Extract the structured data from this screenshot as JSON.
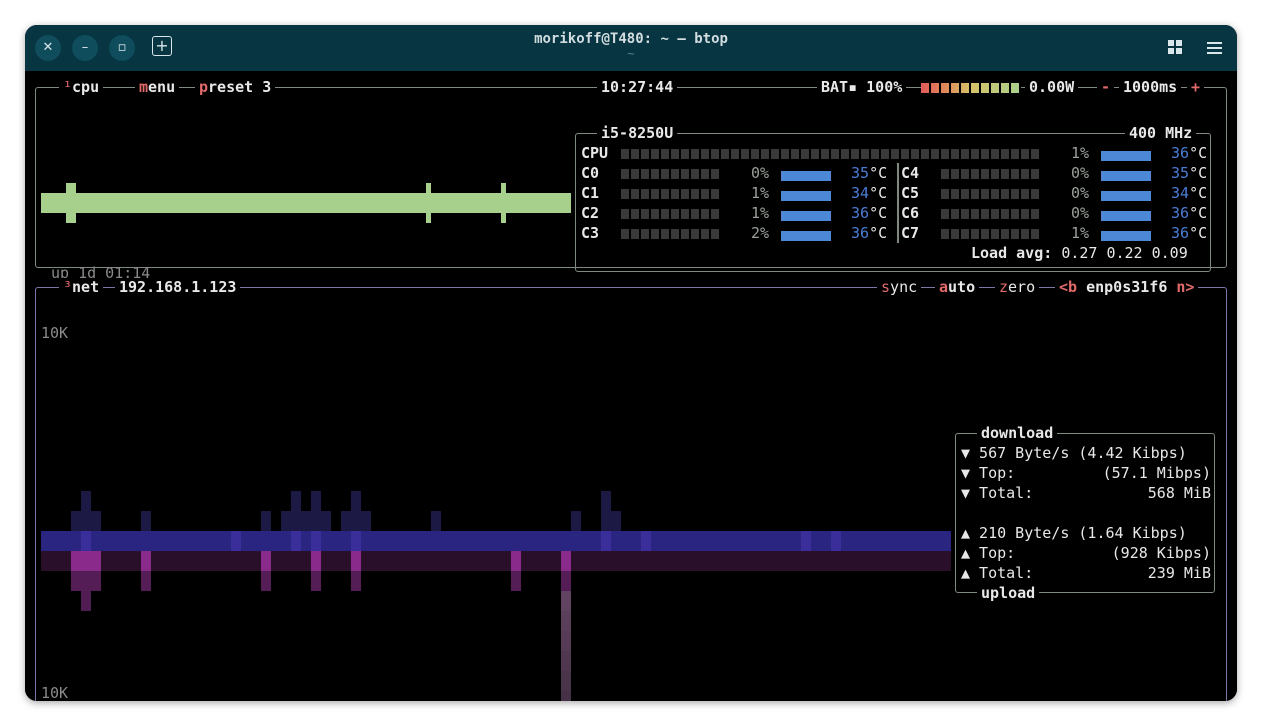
{
  "window": {
    "title": "morikoff@T480: ~ — btop",
    "subtitle": "~",
    "close_icon": "close-icon",
    "min_icon": "minimize-icon",
    "max_icon": "maximize-icon",
    "newtab_icon": "new-tab-icon",
    "grid_icon": "grid-icon",
    "menu_icon": "hamburger-menu-icon"
  },
  "cpu_panel": {
    "tab_num": "¹",
    "tab_label": "cpu",
    "menu_first": "m",
    "menu_rest": "enu",
    "preset_first": "p",
    "preset_rest": "reset 3",
    "clock": "10:27:44",
    "battery": "BAT▪ 100%",
    "power": "0.00W",
    "minus": "-",
    "interval": "1000ms",
    "plus": "+",
    "uptime": "up 1d 01:14",
    "cpu_model": "i5-8250U",
    "freq": "400 MHz",
    "total": {
      "label": "CPU",
      "pct": "1%",
      "temp": "36",
      "unit": "°C"
    },
    "cores": [
      {
        "label": "C0",
        "pct": "0%",
        "temp": "35",
        "unit": "°C"
      },
      {
        "label": "C1",
        "pct": "1%",
        "temp": "34",
        "unit": "°C"
      },
      {
        "label": "C2",
        "pct": "1%",
        "temp": "36",
        "unit": "°C"
      },
      {
        "label": "C3",
        "pct": "2%",
        "temp": "36",
        "unit": "°C"
      },
      {
        "label": "C4",
        "pct": "0%",
        "temp": "35",
        "unit": "°C"
      },
      {
        "label": "C5",
        "pct": "0%",
        "temp": "34",
        "unit": "°C"
      },
      {
        "label": "C6",
        "pct": "0%",
        "temp": "36",
        "unit": "°C"
      },
      {
        "label": "C7",
        "pct": "1%",
        "temp": "36",
        "unit": "°C"
      }
    ],
    "load_label": "Load avg:",
    "load_values": "0.27 0.22 0.09"
  },
  "net_panel": {
    "tab_num": "³",
    "tab_label": "net",
    "ip": "192.168.1.123",
    "sync_first": "s",
    "sync_mid": "y",
    "sync_rest": "nc",
    "auto_label": "auto",
    "zero_first": "z",
    "zero_rest": "ero",
    "prev_iface": "<b",
    "iface": "enp0s31f6",
    "next_iface": "n>",
    "scale_top": "10K",
    "scale_bottom": "10K",
    "download": {
      "title": "download",
      "rate": "▼ 567 Byte/s (4.42 Kibps)",
      "top_label": "▼ Top:",
      "top_value": "(57.1 Mibps)",
      "total_label": "▼ Total:",
      "total_value": "568 MiB"
    },
    "upload": {
      "title": "upload",
      "rate": "▲ 210 Byte/s (1.64 Kibps)",
      "top_label": "▲ Top:",
      "top_value": "(928 Kibps)",
      "total_label": "▲ Total:",
      "total_value": "239 MiB"
    }
  },
  "colors": {
    "titlebar": "#073642",
    "cpu_graph": "#a7d08c",
    "temp_bar": "#4c88d6",
    "net_upload": "#8a2a8a",
    "net_download": "#3a2f9a",
    "highlight_red": "#e26a6a"
  }
}
